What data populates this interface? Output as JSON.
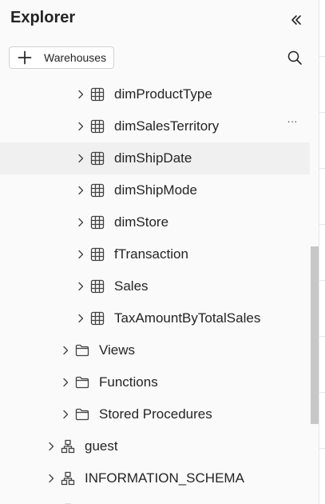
{
  "panel": {
    "title": "Explorer",
    "collapse_icon": "double-chevron-left-icon"
  },
  "toolbar": {
    "warehouses_label": "Warehouses",
    "add_icon": "plus-icon",
    "search_icon": "search-icon"
  },
  "tree": {
    "items": [
      {
        "label": "dimProductType",
        "icon": "table-icon",
        "level": 3
      },
      {
        "label": "dimSalesTerritory",
        "icon": "table-icon",
        "level": 3,
        "more": "···"
      },
      {
        "label": "dimShipDate",
        "icon": "table-icon",
        "level": 3
      },
      {
        "label": "dimShipMode",
        "icon": "table-icon",
        "level": 3
      },
      {
        "label": "dimStore",
        "icon": "table-icon",
        "level": 3
      },
      {
        "label": "fTransaction",
        "icon": "table-icon",
        "level": 3
      },
      {
        "label": "Sales",
        "icon": "table-icon",
        "level": 3
      },
      {
        "label": "TaxAmountByTotalSales",
        "icon": "table-icon",
        "level": 3
      },
      {
        "label": "Views",
        "icon": "folder-icon",
        "level": 2
      },
      {
        "label": "Functions",
        "icon": "folder-icon",
        "level": 2
      },
      {
        "label": "Stored Procedures",
        "icon": "folder-icon",
        "level": 2
      },
      {
        "label": "guest",
        "icon": "schema-icon",
        "level": 1
      },
      {
        "label": "INFORMATION_SCHEMA",
        "icon": "schema-icon",
        "level": 1
      }
    ]
  },
  "colors": {
    "panel_bg": "#fafafa",
    "text": "#242424",
    "scroll_thumb": "#c7c7c7",
    "hover_row": "#f0f0f0"
  }
}
